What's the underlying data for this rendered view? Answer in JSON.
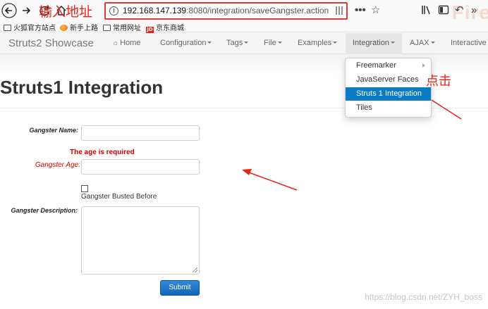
{
  "browser": {
    "url_host": "192.168.147.139",
    "url_path": ":8080/integration/saveGangster.action",
    "annotation_enter_url": "输入地址",
    "watermark_logo": "Fire",
    "bookmarks": [
      {
        "label": "火狐官方站点",
        "icon": "folder-icon"
      },
      {
        "label": "新手上路",
        "icon": "firefox-icon"
      },
      {
        "label": "常用网址",
        "icon": "folder-icon"
      },
      {
        "label": "京东商城",
        "icon": "jd-icon"
      }
    ]
  },
  "navbar": {
    "brand": "Struts2 Showcase",
    "items": [
      {
        "label": "Home",
        "icon": "home-icon"
      },
      {
        "label": "Configuration"
      },
      {
        "label": "Tags"
      },
      {
        "label": "File"
      },
      {
        "label": "Examples"
      },
      {
        "label": "Integration",
        "active": true
      },
      {
        "label": "AJAX"
      },
      {
        "label": "Interactive"
      }
    ]
  },
  "dropdown": {
    "items": [
      {
        "label": "Freemarker",
        "has_submenu": true
      },
      {
        "label": "JavaServer Faces"
      },
      {
        "label": "Struts 1 Integration",
        "selected": true
      },
      {
        "label": "Tiles"
      }
    ],
    "annotation_click": "点击"
  },
  "page": {
    "title": "Struts1 Integration",
    "form": {
      "name_label": "Gangster Name:",
      "name_value": "",
      "age_error": "The age is required",
      "age_label": "Gangster Age:",
      "age_value": "",
      "busted_label": "Gangster Busted Before",
      "busted_checked": false,
      "description_label": "Gangster Description:",
      "description_value": "",
      "submit_label": "Submit"
    }
  },
  "watermark": "https://blog.csdn.net/ZYH_boss",
  "colors": {
    "annotation_red": "#e8231c",
    "error_red": "#d10000",
    "selected_blue": "#0a7bc4",
    "submit_blue": "#1f75c6"
  }
}
